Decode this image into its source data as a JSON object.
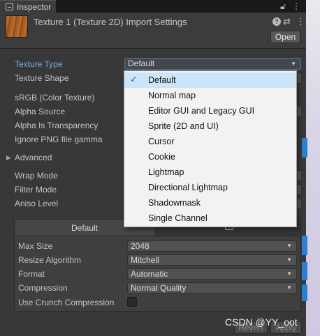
{
  "tab": {
    "title": "Inspector"
  },
  "header": {
    "title": "Texture 1 (Texture 2D) Import Settings",
    "help_glyph": "?",
    "open_label": "Open"
  },
  "properties": {
    "texture_type": {
      "label": "Texture Type",
      "value": "Default"
    },
    "texture_shape": {
      "label": "Texture Shape"
    },
    "srgb": {
      "label": "sRGB (Color Texture)"
    },
    "alpha_source": {
      "label": "Alpha Source"
    },
    "alpha_transparency": {
      "label": "Alpha Is Transparency"
    },
    "ignore_png_gamma": {
      "label": "Ignore PNG file gamma"
    },
    "advanced": {
      "label": "Advanced"
    },
    "wrap_mode": {
      "label": "Wrap Mode"
    },
    "filter_mode": {
      "label": "Filter Mode"
    },
    "aniso_level": {
      "label": "Aniso Level"
    }
  },
  "platform": {
    "tab_default": "Default",
    "max_size": {
      "label": "Max Size",
      "value": "2048"
    },
    "resize_algorithm": {
      "label": "Resize Algorithm",
      "value": "Mitchell"
    },
    "format": {
      "label": "Format",
      "value": "Automatic"
    },
    "compression": {
      "label": "Compression",
      "value": "Normal Quality"
    },
    "crunch": {
      "label": "Use Crunch Compression",
      "checked": false
    }
  },
  "buttons": {
    "revert": "Revert",
    "apply": "Apply"
  },
  "dropdown": {
    "items": [
      "Default",
      "Normal map",
      "Editor GUI and Legacy GUI",
      "Sprite (2D and UI)",
      "Cursor",
      "Cookie",
      "Lightmap",
      "Directional Lightmap",
      "Shadowmask",
      "Single Channel"
    ],
    "selected_index": 0,
    "check_glyph": "✓"
  },
  "watermark": "CSDN @YY_oot",
  "colors": {
    "accent_label": "#7aa9e6",
    "selected_item_bg": "#cce4f7",
    "focus_border": "#3d7ec7"
  }
}
